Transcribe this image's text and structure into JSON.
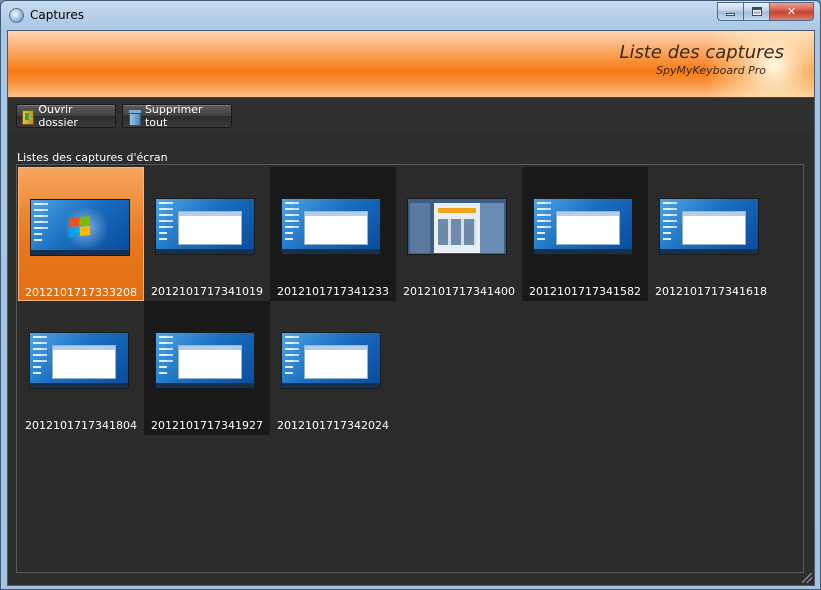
{
  "window": {
    "title": "Captures",
    "app_icon": "app-icon",
    "controls": {
      "minimize": "minimize-icon",
      "maximize": "maximize-icon",
      "close": "✕"
    }
  },
  "banner": {
    "title": "Liste des captures",
    "subtitle": "SpyMyKeyboard Pro"
  },
  "toolbar": {
    "open_folder_label": "Ouvrir dossier",
    "open_folder_icon": "folder-icon",
    "delete_all_label": "Supprimer tout",
    "delete_all_icon": "trash-icon"
  },
  "section": {
    "label": "Listes des captures d'écran"
  },
  "captures": [
    {
      "name": "2012101717333208",
      "preview": "desktop-logo",
      "state": "selected"
    },
    {
      "name": "2012101717341019",
      "preview": "desktop-window",
      "state": "normal"
    },
    {
      "name": "2012101717341233",
      "preview": "desktop-window",
      "state": "hover"
    },
    {
      "name": "2012101717341400",
      "preview": "browser-page",
      "state": "normal"
    },
    {
      "name": "2012101717341582",
      "preview": "desktop-window",
      "state": "hover"
    },
    {
      "name": "2012101717341618",
      "preview": "desktop-window",
      "state": "normal"
    },
    {
      "name": "2012101717341804",
      "preview": "desktop-window",
      "state": "normal"
    },
    {
      "name": "2012101717341927",
      "preview": "desktop-window",
      "state": "hover"
    },
    {
      "name": "2012101717342024",
      "preview": "desktop-window",
      "state": "normal"
    }
  ],
  "colors": {
    "accent_orange": "#f47a16",
    "background_dark": "#2e2e2e",
    "text_white": "#ffffff"
  }
}
